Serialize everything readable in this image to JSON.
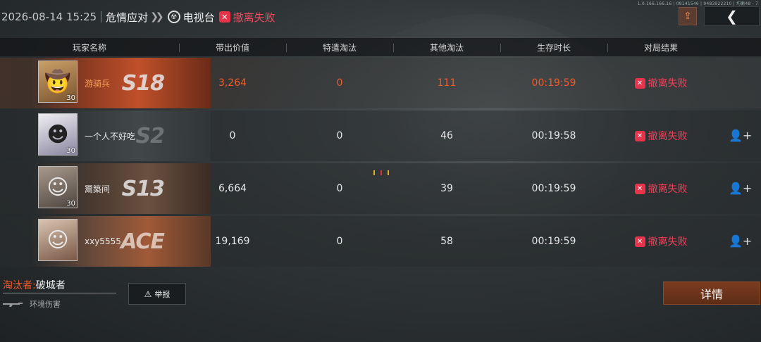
{
  "build_info": "1.0.166.166.16 | 08141546 | 9483922210 | 均衡48 - 7",
  "topbar": {
    "timestamp": "2026-08-14 15:25",
    "mode": "危情应对",
    "map": "电视台",
    "result": "撤离失败"
  },
  "columns": [
    "玩家名称",
    "带出价值",
    "特遣淘汰",
    "其他淘汰",
    "生存时长",
    "对局结果"
  ],
  "players": [
    {
      "name": "游骑兵",
      "level": "30",
      "banner": "S18",
      "value": "3,264",
      "special_kills": "0",
      "other_kills": "111",
      "survival": "00:19:59",
      "result": "撤离失败"
    },
    {
      "name": "一个人不好吃",
      "level": "30",
      "banner": "S2",
      "value": "0",
      "special_kills": "0",
      "other_kills": "46",
      "survival": "00:19:58",
      "result": "撤离失败"
    },
    {
      "name": "鬻築间",
      "level": "30",
      "banner": "S13",
      "value": "6,664",
      "special_kills": "0",
      "other_kills": "39",
      "survival": "00:19:59",
      "result": "撤离失败"
    },
    {
      "name": "xxy5555",
      "level": "",
      "banner": "ACE",
      "value": "19,169",
      "special_kills": "0",
      "other_kills": "58",
      "survival": "00:19:59",
      "result": "撤离失败"
    }
  ],
  "killer": {
    "label": "淘汰者:",
    "name": "破城者",
    "cause": "环境伤害"
  },
  "buttons": {
    "report": "举报",
    "detail": "详情"
  },
  "colors": {
    "accent_orange": "#f05a2a",
    "fail_red": "#f0405a",
    "detail_button": "#6e3219"
  }
}
